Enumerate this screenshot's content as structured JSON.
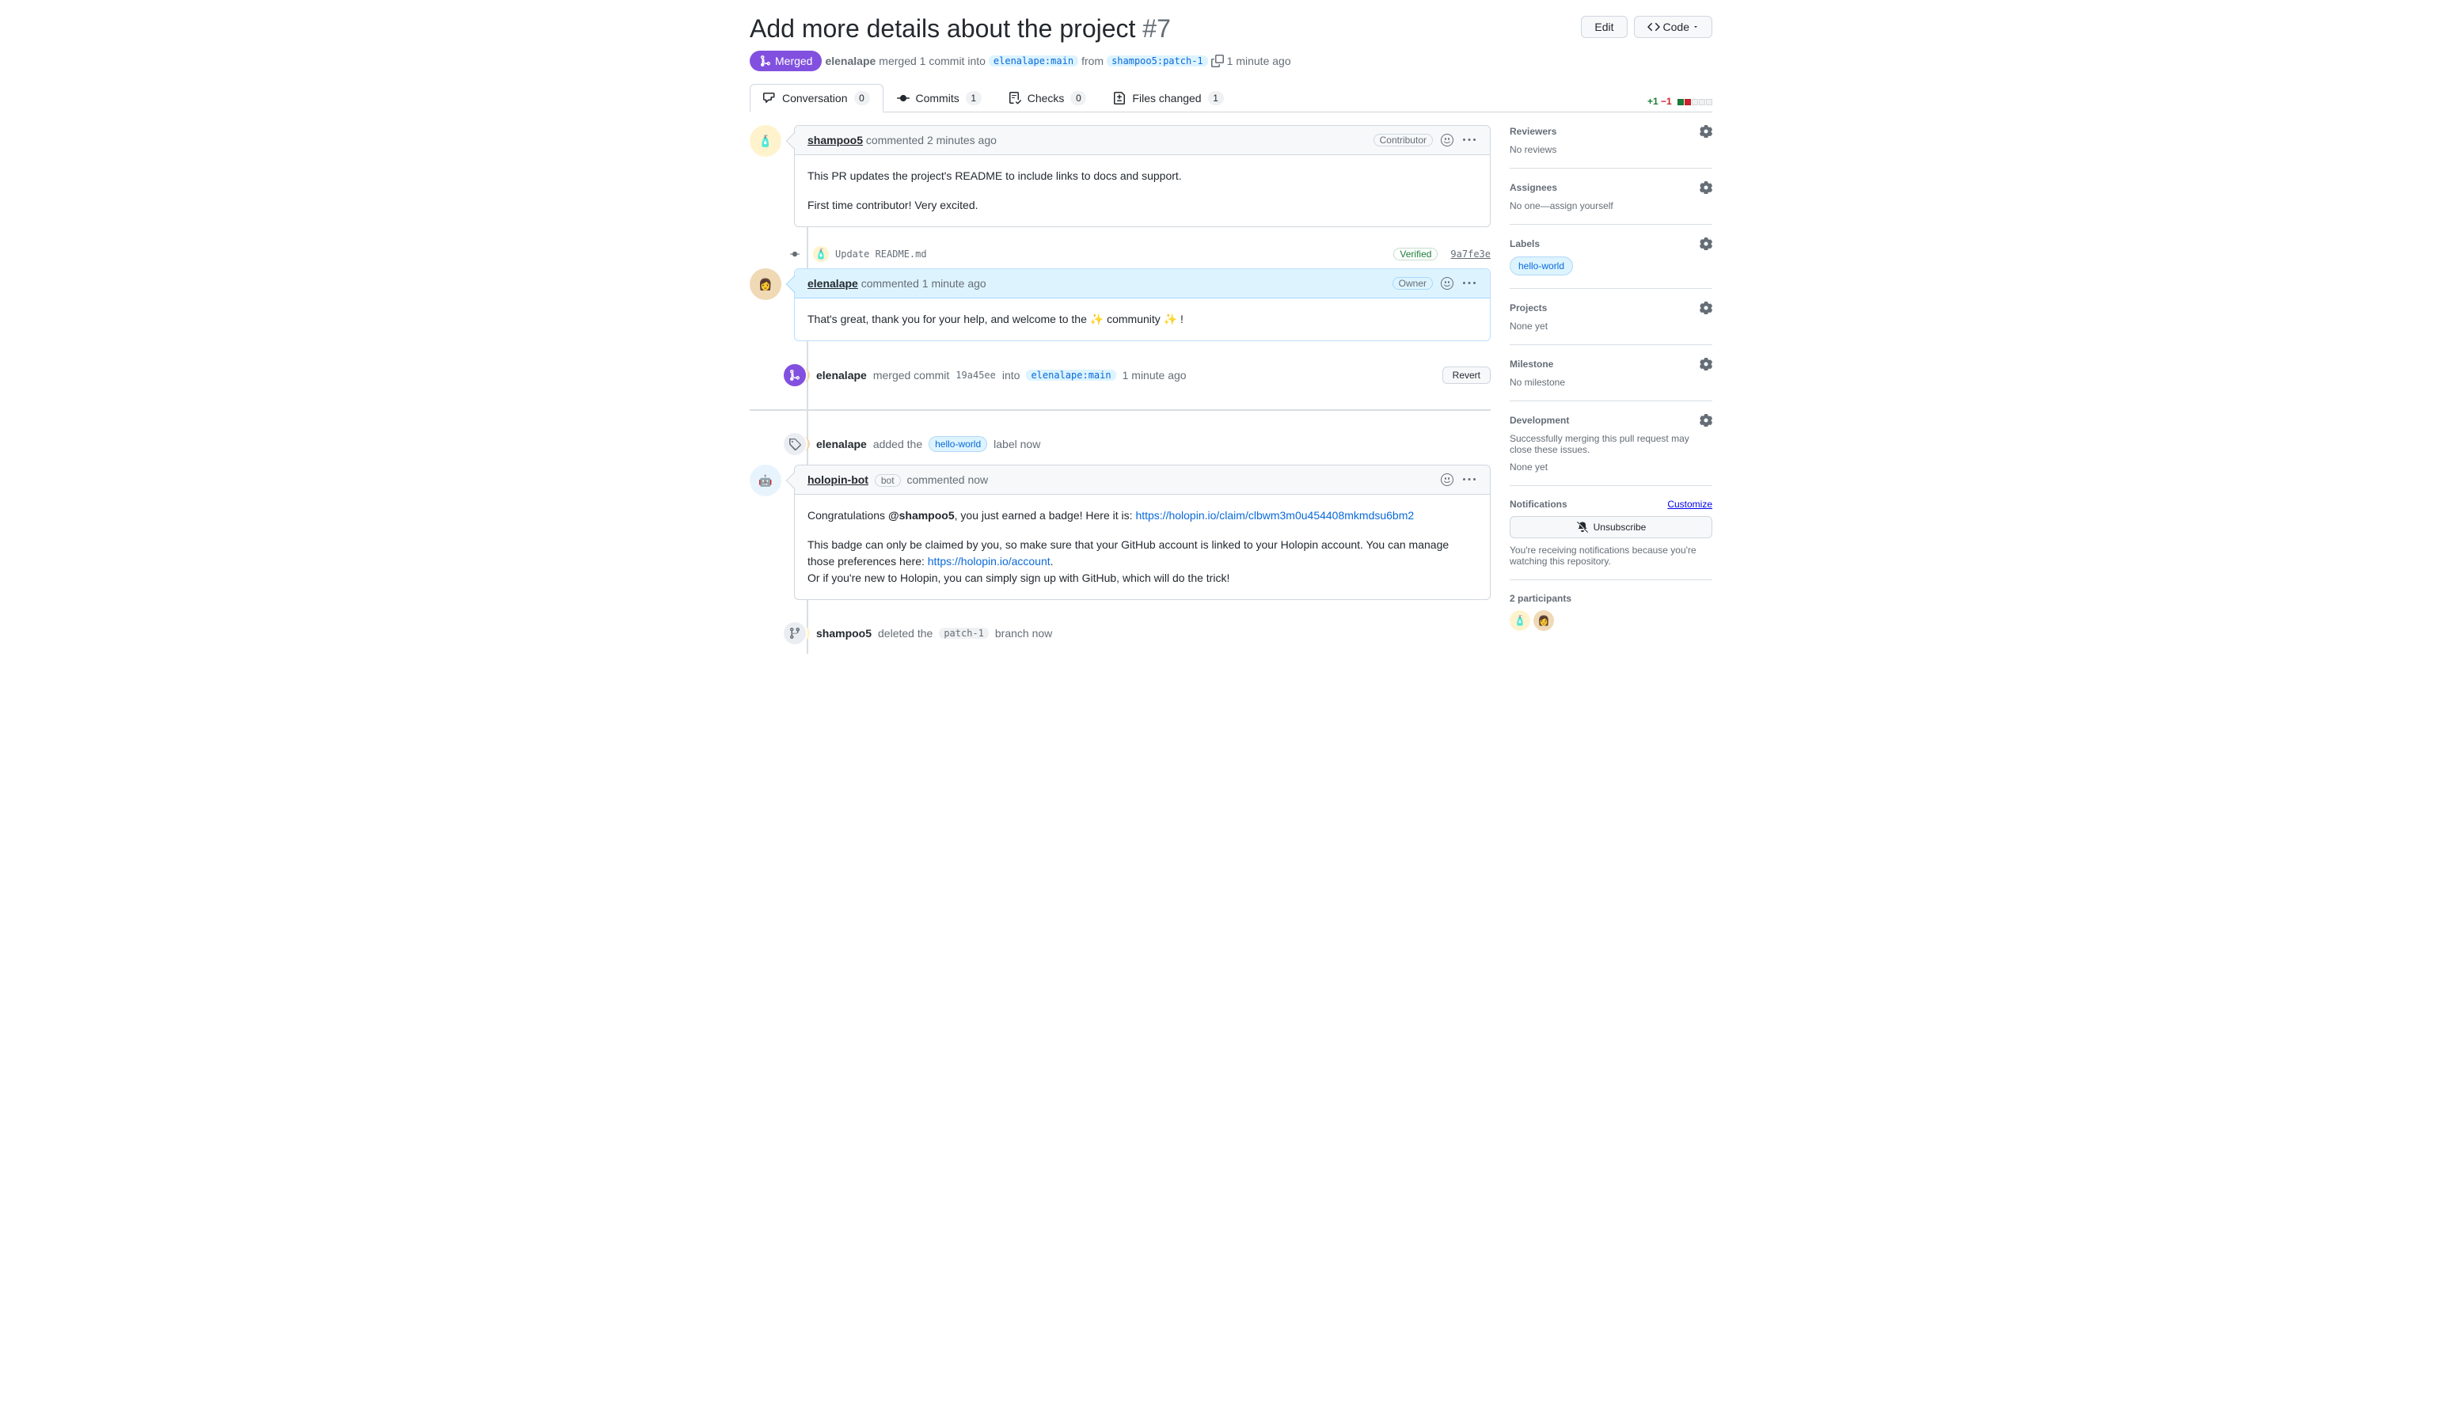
{
  "header": {
    "title": "Add more details about the project",
    "number": "#7",
    "edit_label": "Edit",
    "code_label": "Code",
    "state": "Merged",
    "author": "elenalape",
    "merged_text": "merged 1 commit into",
    "base_branch": "elenalape:main",
    "from_text": "from",
    "head_branch": "shampoo5:patch-1",
    "timestamp": "1 minute ago"
  },
  "tabs": {
    "conversation": {
      "label": "Conversation",
      "count": "0"
    },
    "commits": {
      "label": "Commits",
      "count": "1"
    },
    "checks": {
      "label": "Checks",
      "count": "0"
    },
    "files": {
      "label": "Files changed",
      "count": "1"
    }
  },
  "diffstat": {
    "additions": "+1",
    "deletions": "−1"
  },
  "sidebar": {
    "reviewers": {
      "title": "Reviewers",
      "body": "No reviews"
    },
    "assignees": {
      "title": "Assignees",
      "body_prefix": "No one—",
      "body_link": "assign yourself"
    },
    "labels": {
      "title": "Labels",
      "label": "hello-world"
    },
    "projects": {
      "title": "Projects",
      "body": "None yet"
    },
    "milestone": {
      "title": "Milestone",
      "body": "No milestone"
    },
    "development": {
      "title": "Development",
      "body": "Successfully merging this pull request may close these issues.",
      "none": "None yet"
    },
    "notifications": {
      "title": "Notifications",
      "customize": "Customize",
      "unsubscribe": "Unsubscribe",
      "reason": "You're receiving notifications because you're watching this repository."
    },
    "participants": {
      "title": "2 participants"
    }
  },
  "timeline": {
    "comment1": {
      "author": "shampoo5",
      "verb": "commented",
      "timestamp": "2 minutes ago",
      "role": "Contributor",
      "body1": "This PR updates the project's README to include links to docs and support.",
      "body2": "First time contributor! Very excited."
    },
    "commit1": {
      "msg": "Update README.md",
      "verified": "Verified",
      "sha": "9a7fe3e"
    },
    "comment2": {
      "author": "elenalape",
      "verb": "commented",
      "timestamp": "1 minute ago",
      "role": "Owner",
      "body": "That's great, thank you for your help, and welcome to the ✨ community ✨ !"
    },
    "merge_event": {
      "author": "elenalape",
      "text1": "merged commit",
      "sha": "19a45ee",
      "text2": "into",
      "branch": "elenalape:main",
      "timestamp": "1 minute ago",
      "revert": "Revert"
    },
    "label_event": {
      "author": "elenalape",
      "text1": "added the",
      "label": "hello-world",
      "text2": "label now"
    },
    "comment3": {
      "author": "holopin-bot",
      "bot_badge": "bot",
      "verb": "commented",
      "timestamp": "now",
      "body_p1_prefix": "Congratulations ",
      "body_p1_mention": "@shampoo5",
      "body_p1_mid": ", you just earned a badge! Here it is: ",
      "body_p1_link": "https://holopin.io/claim/clbwm3m0u454408mkmdsu6bm2",
      "body_p2": "This badge can only be claimed by you, so make sure that your GitHub account is linked to your Holopin account. You can manage those preferences here: ",
      "body_p2_link": "https://holopin.io/account",
      "body_p2_suffix": ".",
      "body_p3": "Or if you're new to Holopin, you can simply sign up with GitHub, which will do the trick!"
    },
    "delete_event": {
      "author": "shampoo5",
      "text1": "deleted the",
      "branch": "patch-1",
      "text2": "branch now"
    }
  }
}
